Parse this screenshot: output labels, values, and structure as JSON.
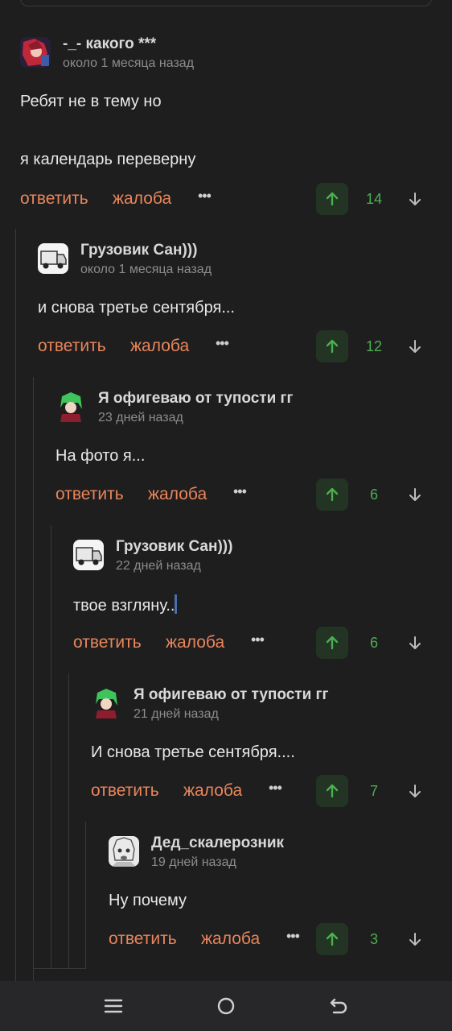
{
  "comments": [
    {
      "author": "-_- какого ***",
      "time": "около 1 месяца назад",
      "text_lines": [
        "Ребят не в тему но",
        "",
        "я календарь переверну"
      ],
      "reply": "ответить",
      "report": "жалоба",
      "more": "•••",
      "score": "14",
      "avatar": "avatar-anime-red"
    },
    {
      "author": "Грузовик Сан)))",
      "time": "около 1 месяца назад",
      "text_lines": [
        "и снова третье сентября..."
      ],
      "reply": "ответить",
      "report": "жалоба",
      "more": "•••",
      "score": "12",
      "avatar": "avatar-truck"
    },
    {
      "author": "Я офигеваю от тупости гг",
      "time": "23 дней назад",
      "text_lines": [
        "На фото я..."
      ],
      "reply": "ответить",
      "report": "жалоба",
      "more": "•••",
      "score": "6",
      "avatar": "avatar-green-hair"
    },
    {
      "author": "Грузовик Сан)))",
      "time": "22 дней назад",
      "text_lines": [
        "твое взгляну.."
      ],
      "reply": "ответить",
      "report": "жалоба",
      "more": "•••",
      "score": "6",
      "avatar": "avatar-truck"
    },
    {
      "author": "Я офигеваю от тупости гг",
      "time": "21 дней назад",
      "text_lines": [
        "И снова третье сентября...."
      ],
      "reply": "ответить",
      "report": "жалоба",
      "more": "•••",
      "score": "7",
      "avatar": "avatar-green-hair"
    },
    {
      "author": "Дед_скалерозник",
      "time": "19 дней назад",
      "text_lines": [
        "Ну почему"
      ],
      "reply": "ответить",
      "report": "жалоба",
      "more": "•••",
      "score": "3",
      "avatar": "avatar-manga-sketch"
    }
  ],
  "colors": {
    "action": "#e9855b",
    "score": "#4caf50",
    "upvote_bg": "#233324",
    "background": "#1e1e1f"
  },
  "nav": [
    "menu-icon",
    "home-icon",
    "back-icon"
  ]
}
